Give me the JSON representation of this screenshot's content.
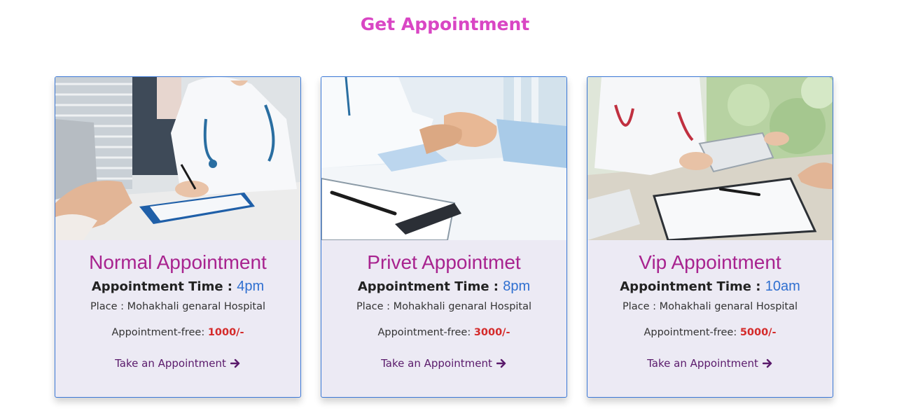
{
  "heading": "Get Appointment",
  "cards": [
    {
      "title": "Normal Appointment",
      "time_label": "Appointment Time :",
      "time_value": "4pm",
      "place": "Place : Mohakhali genaral Hospital",
      "fee_label": "Appointment-free:",
      "fee_value": "1000/-",
      "cta": "Take an Appointment"
    },
    {
      "title": "Privet Appointmet",
      "time_label": "Appointment Time :",
      "time_value": "8pm",
      "place": "Place : Mohakhali genaral Hospital",
      "fee_label": "Appointment-free:",
      "fee_value": "3000/-",
      "cta": "Take an Appointment"
    },
    {
      "title": "Vip Appointment",
      "time_label": "Appointment Time :",
      "time_value": "10am",
      "place": "Place : Mohakhali genaral Hospital",
      "fee_label": "Appointment-free:",
      "fee_value": "5000/-",
      "cta": "Take an Appointment"
    }
  ],
  "colors": {
    "heading": "#d946c4",
    "card_title": "#a8238f",
    "time_value": "#2f6fd0",
    "fee_value": "#d42a2a",
    "cta": "#5a1a6b",
    "card_bg": "#eceaf4",
    "card_border": "#3b78d6"
  },
  "icons": {
    "cta_arrow": "arrow-right-icon"
  }
}
